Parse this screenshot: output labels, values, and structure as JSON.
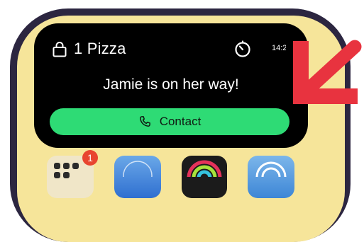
{
  "live_activity": {
    "order_title": "1 Pizza",
    "clock": "14:2",
    "status_message": "Jamie is on her way!",
    "contact_button_label": "Contact",
    "icons": {
      "order": "shopping-bag-icon",
      "timer": "timer-icon",
      "call": "phone-icon"
    },
    "colors": {
      "background": "#000000",
      "button": "#2edb75",
      "text": "#ffffff"
    }
  },
  "home_screen": {
    "background": "#f6e59a",
    "app_badge_count": "1",
    "apps": [
      "app-grid-icon",
      "safari-icon",
      "fitness-icon",
      "airdrop-icon"
    ]
  },
  "annotation": {
    "arrow_color": "#e8333f",
    "arrow_direction": "down-left"
  }
}
